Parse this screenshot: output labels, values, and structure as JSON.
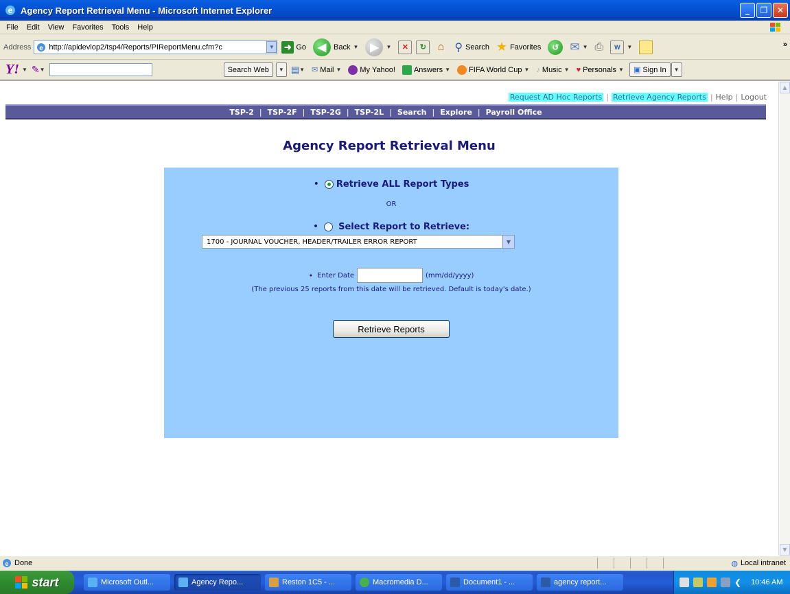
{
  "window": {
    "title": "Agency Report Retrieval Menu - Microsoft Internet Explorer"
  },
  "menu": [
    "File",
    "Edit",
    "View",
    "Favorites",
    "Tools",
    "Help"
  ],
  "address": {
    "label": "Address",
    "url": "http://apidevlop2/tsp4/Reports/PIReportMenu.cfm?c",
    "go": "Go"
  },
  "toolbar": {
    "back": "Back",
    "search": "Search",
    "favorites": "Favorites"
  },
  "yahoo": {
    "search_button": "Search Web",
    "items": [
      "Mail",
      "My Yahoo!",
      "Answers",
      "FIFA World Cup",
      "Music",
      "Personals",
      "Sign In"
    ]
  },
  "toplinks": {
    "adhoc": "Request AD Hoc Reports",
    "retrieve": "Retrieve Agency Reports",
    "help": "Help",
    "logout": "Logout"
  },
  "nav": [
    "TSP-2",
    "TSP-2F",
    "TSP-2G",
    "TSP-2L",
    "Search",
    "Explore",
    "Payroll Office"
  ],
  "page": {
    "heading": "Agency Report Retrieval Menu",
    "option_all": "Retrieve ALL Report Types",
    "or": "OR",
    "option_select": "Select Report to Retrieve:",
    "selected_report": "1700 - JOURNAL VOUCHER, HEADER/TRAILER ERROR REPORT",
    "date_label": "Enter Date",
    "date_value": "",
    "date_format": "(mm/dd/yyyy)",
    "date_note": "(The previous 25 reports from this date will be retrieved. Default is today's date.)",
    "submit": "Retrieve Reports"
  },
  "status": {
    "text": "Done",
    "zone": "Local intranet"
  },
  "taskbar": {
    "start": "start",
    "tasks": [
      "Microsoft Outl...",
      "Agency Repo...",
      "Reston 1C5 - ...",
      "Macromedia D...",
      "Document1 - ...",
      "agency report..."
    ],
    "clock": "10:46 AM"
  }
}
